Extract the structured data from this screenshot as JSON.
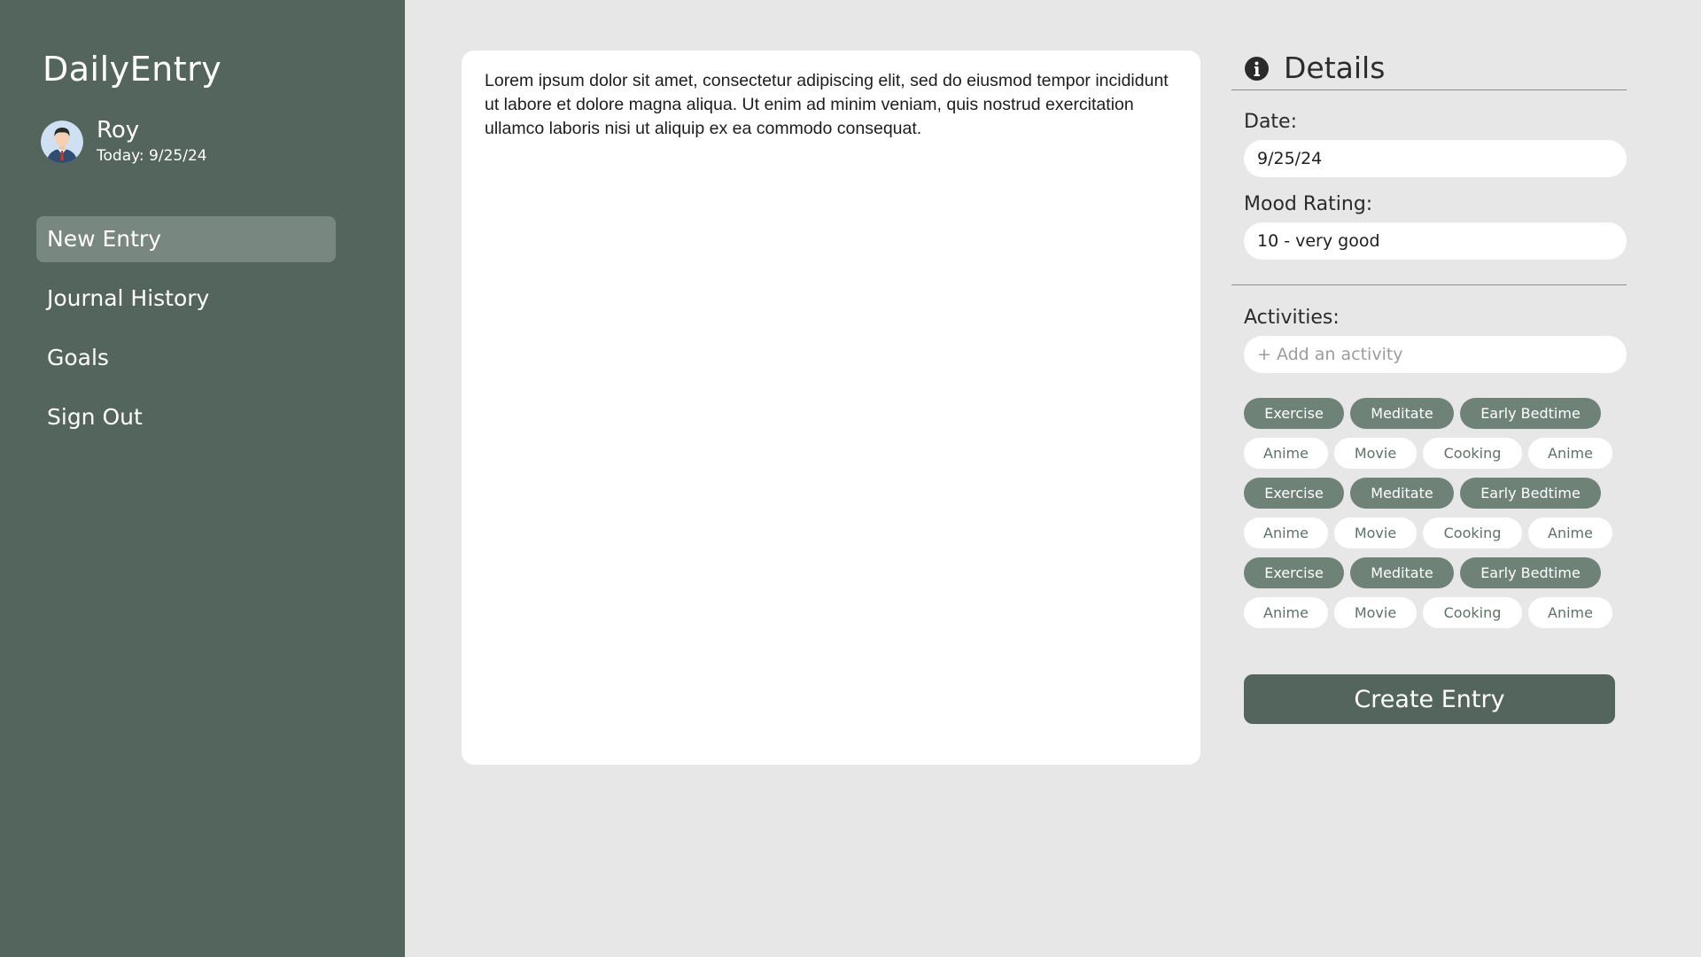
{
  "app": {
    "title": "DailyEntry"
  },
  "user": {
    "name": "Roy",
    "today": "Today: 9/25/24"
  },
  "nav": {
    "items": [
      {
        "label": "New Entry",
        "active": true
      },
      {
        "label": "Journal History"
      },
      {
        "label": "Goals"
      },
      {
        "label": "Sign Out"
      }
    ]
  },
  "editor": {
    "text": "Lorem ipsum dolor sit amet, consectetur adipiscing elit, sed do eiusmod tempor incididunt ut labore et dolore magna aliqua. Ut enim ad minim veniam, quis nostrud exercitation ullamco laboris nisi ut aliquip ex ea commodo consequat."
  },
  "details": {
    "title": "Details",
    "icon": "info-icon",
    "date_label": "Date:",
    "date_value": "9/25/24",
    "mood_label": "Mood Rating:",
    "mood_value": "10 - very good",
    "activities_label": "Activities:",
    "activity_placeholder": "+ Add an activity",
    "activities": [
      {
        "label": "Exercise",
        "selected": true
      },
      {
        "label": "Meditate",
        "selected": true
      },
      {
        "label": "Early Bedtime",
        "selected": true
      },
      {
        "label": "Anime",
        "selected": false
      },
      {
        "label": "Movie",
        "selected": false
      },
      {
        "label": "Cooking",
        "selected": false
      },
      {
        "label": "Anime",
        "selected": false
      },
      {
        "label": "Exercise",
        "selected": true
      },
      {
        "label": "Meditate",
        "selected": true
      },
      {
        "label": "Early Bedtime",
        "selected": true
      },
      {
        "label": "Anime",
        "selected": false
      },
      {
        "label": "Movie",
        "selected": false
      },
      {
        "label": "Cooking",
        "selected": false
      },
      {
        "label": "Anime",
        "selected": false
      },
      {
        "label": "Exercise",
        "selected": true
      },
      {
        "label": "Meditate",
        "selected": true
      },
      {
        "label": "Early Bedtime",
        "selected": true
      },
      {
        "label": "Anime",
        "selected": false
      },
      {
        "label": "Movie",
        "selected": false
      },
      {
        "label": "Cooking",
        "selected": false
      },
      {
        "label": "Anime",
        "selected": false
      }
    ],
    "create_label": "Create Entry"
  },
  "colors": {
    "sidebar": "#53655d",
    "nav_active": "#78877f",
    "chip_selected": "#6e8278",
    "chip_text": "#5e7268",
    "background": "#e7e7e7"
  }
}
